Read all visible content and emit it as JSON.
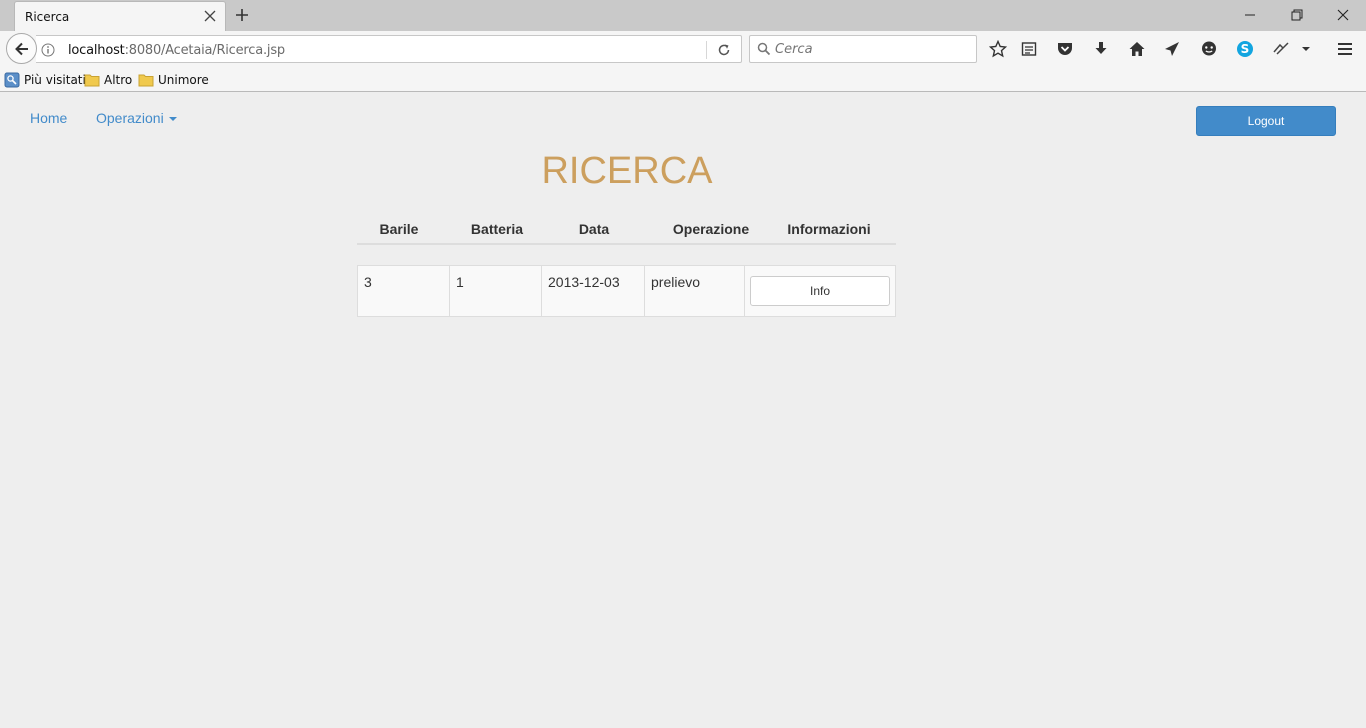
{
  "browser": {
    "tab_title": "Ricerca",
    "url_host": "localhost",
    "url_rest": ":8080/Acetaia/Ricerca.jsp",
    "search_placeholder": "Cerca",
    "bookmarks": [
      "Più visitati",
      "Altro",
      "Unimore"
    ]
  },
  "nav": {
    "home_label": "Home",
    "operations_label": "Operazioni",
    "logout_label": "Logout"
  },
  "page": {
    "title": "RICERCA"
  },
  "table": {
    "headers": [
      "Barile",
      "Batteria",
      "Data",
      "Operazione",
      "Informazioni"
    ],
    "rows": [
      {
        "barile": "3",
        "batteria": "1",
        "data": "2013-12-03",
        "operazione": "prelievo",
        "button_label": "Info"
      }
    ]
  },
  "colors": {
    "link": "#428bca",
    "title": "#cc9f5e",
    "primary_button": "#428bca",
    "background": "#eeeeee"
  },
  "icons": [
    "back-arrow-icon",
    "info-icon",
    "reload-icon",
    "search-icon",
    "star-icon",
    "reader-icon",
    "pocket-icon",
    "download-icon",
    "home-icon",
    "send-icon",
    "chat-icon",
    "skype-icon",
    "extension-icon",
    "menu-icon"
  ]
}
